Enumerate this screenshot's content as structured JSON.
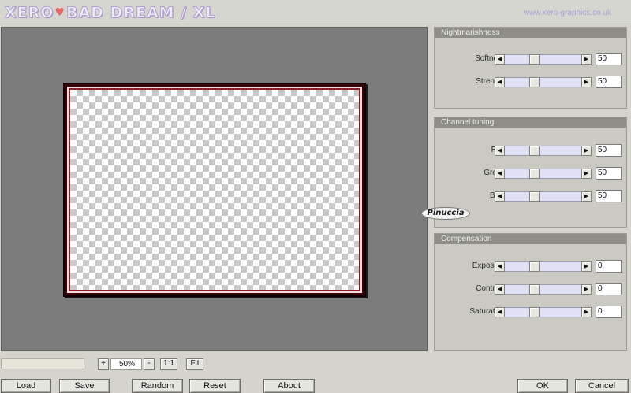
{
  "header": {
    "logo_part1": "XERO",
    "logo_separator": "♥",
    "logo_part2": "BAD DREAM / XL",
    "site_url": "www.xero-graphics.co.uk"
  },
  "panels": {
    "nightmarishness": {
      "title": "Nightmarishness",
      "params": [
        {
          "label": "Softness",
          "value": "50",
          "slider_fraction": 0.5
        },
        {
          "label": "Strength",
          "value": "50",
          "slider_fraction": 0.5
        }
      ]
    },
    "channel_tuning": {
      "title": "Channel tuning",
      "params": [
        {
          "label": "Red",
          "value": "50",
          "slider_fraction": 0.5
        },
        {
          "label": "Green",
          "value": "50",
          "slider_fraction": 0.5
        },
        {
          "label": "Blue",
          "value": "50",
          "slider_fraction": 0.5
        }
      ]
    },
    "compensation": {
      "title": "Compensation",
      "params": [
        {
          "label": "Exposure",
          "value": "0",
          "slider_fraction": 0.5
        },
        {
          "label": "Contrast",
          "value": "0",
          "slider_fraction": 0.5
        },
        {
          "label": "Saturation",
          "value": "0",
          "slider_fraction": 0.5
        }
      ]
    }
  },
  "signature_badge": "Pinuccia",
  "zoom": {
    "plus_label": "+",
    "value": "50%",
    "minus_label": "-",
    "one_to_one_label": "1:1",
    "fit_label": "Fit"
  },
  "buttons": {
    "load": "Load",
    "save": "Save",
    "random": "Random",
    "reset": "Reset",
    "about": "About",
    "ok": "OK",
    "cancel": "Cancel"
  },
  "icons": {
    "scroll_left": "arrow-left-icon",
    "scroll_right": "arrow-right-icon"
  },
  "colors": {
    "frame": "#8b1c2c",
    "slider_track": "#e0e0f6",
    "panel_title_bg": "#8e8e86"
  }
}
